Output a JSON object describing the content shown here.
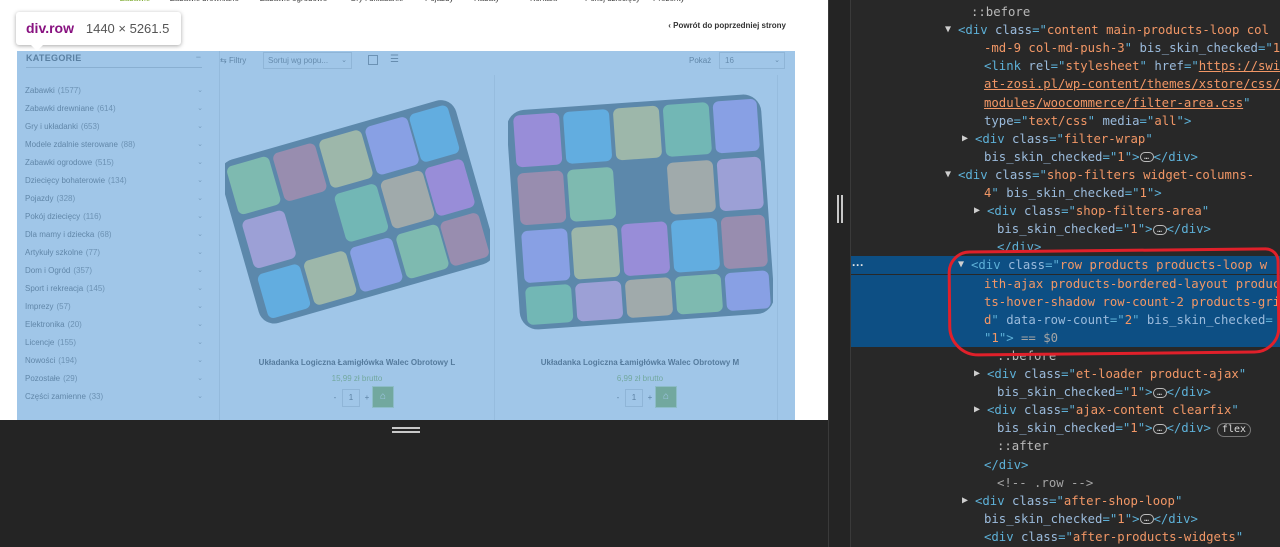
{
  "page": {
    "nav_items": [
      "Zabawki",
      "Zabawki drewniane",
      "Zabawki ogrodowe",
      "Gry i układanki",
      "Pojazdy",
      "Rabaty",
      "Kontakt",
      "Pokój dziecięcy",
      "Prezenty"
    ],
    "back_link": "‹ Powrót do poprzedniej strony",
    "categories_title": "KATEGORIE",
    "categories": [
      {
        "label": "Zabawki",
        "count": "(1577)"
      },
      {
        "label": "Zabawki drewniane",
        "count": "(614)"
      },
      {
        "label": "Gry i układanki",
        "count": "(653)"
      },
      {
        "label": "Modele zdalnie sterowane",
        "count": "(88)"
      },
      {
        "label": "Zabawki ogrodowe",
        "count": "(515)"
      },
      {
        "label": "Dziecięcy bohaterowie",
        "count": "(134)"
      },
      {
        "label": "Pojazdy",
        "count": "(328)"
      },
      {
        "label": "Pokój dziecięcy",
        "count": "(116)"
      },
      {
        "label": "Dla mamy i dziecka",
        "count": "(68)"
      },
      {
        "label": "Artykuły szkolne",
        "count": "(77)"
      },
      {
        "label": "Dom i Ogród",
        "count": "(357)"
      },
      {
        "label": "Sport i rekreacja",
        "count": "(145)"
      },
      {
        "label": "Imprezy",
        "count": "(57)"
      },
      {
        "label": "Elektronika",
        "count": "(20)"
      },
      {
        "label": "Licencje",
        "count": "(155)"
      },
      {
        "label": "Nowości",
        "count": "(194)"
      },
      {
        "label": "Pozostałe",
        "count": "(29)"
      },
      {
        "label": "Części zamienne",
        "count": "(33)"
      }
    ],
    "toolbar": {
      "filters": "Filtry",
      "sort": "Sortuj wg popu...",
      "show_label": "Pokaż",
      "show_value": "16"
    },
    "products": [
      {
        "name": "Układanka Logiczna Łamigłówka Walec Obrotowy L",
        "price": "15,99 zł brutto",
        "qty": "1"
      },
      {
        "name": "Układanka Logiczna Łamigłówka Walec Obrotowy M",
        "price": "6,99 zł brutto",
        "qty": "1"
      }
    ]
  },
  "inspect_tooltip": {
    "tag": "div.row",
    "dims": "1440 × 5261.5"
  },
  "devtools": {
    "lines": [
      {
        "tri": "",
        "pre": "",
        "parts": [
          [
            "pseudo",
            "::before"
          ]
        ]
      },
      {
        "tri": "▼",
        "pre": "",
        "parts": [
          [
            "tg",
            "<div "
          ],
          [
            "an",
            "class"
          ],
          [
            "tg",
            "=\""
          ],
          [
            "av",
            "content main-products-loop col"
          ]
        ]
      },
      {
        "tri": "",
        "pre": "",
        "parts": [
          [
            "av",
            "-md-9 col-md-push-3"
          ],
          [
            "tg",
            "\" "
          ],
          [
            "an",
            "bis_skin_checked"
          ],
          [
            "tg",
            "=\""
          ],
          [
            "av",
            "1"
          ],
          [
            "tg",
            "\">"
          ]
        ]
      },
      {
        "tri": "",
        "pre": "",
        "parts": [
          [
            "tg",
            "<link "
          ],
          [
            "an",
            "rel"
          ],
          [
            "tg",
            "=\""
          ],
          [
            "av",
            "stylesheet"
          ],
          [
            "tg",
            "\" "
          ],
          [
            "an",
            "href"
          ],
          [
            "tg",
            "=\""
          ],
          [
            "url",
            "https://swi"
          ]
        ]
      },
      {
        "tri": "",
        "pre": "",
        "parts": [
          [
            "url",
            "at-zosi.pl/wp-content/themes/xstore/css/"
          ]
        ]
      },
      {
        "tri": "",
        "pre": "",
        "parts": [
          [
            "url",
            "modules/woocommerce/filter-area.css"
          ],
          [
            "tg",
            "\""
          ]
        ]
      },
      {
        "tri": "",
        "pre": "",
        "parts": [
          [
            "an",
            "type"
          ],
          [
            "tg",
            "=\""
          ],
          [
            "av",
            "text/css"
          ],
          [
            "tg",
            "\" "
          ],
          [
            "an",
            "media"
          ],
          [
            "tg",
            "=\""
          ],
          [
            "av",
            "all"
          ],
          [
            "tg",
            "\">"
          ]
        ]
      },
      {
        "tri": "▶",
        "pre": "",
        "parts": [
          [
            "tg",
            "<div "
          ],
          [
            "an",
            "class"
          ],
          [
            "tg",
            "=\""
          ],
          [
            "av",
            "filter-wrap"
          ],
          [
            "tg",
            "\""
          ]
        ]
      },
      {
        "tri": "",
        "pre": "",
        "parts": [
          [
            "an",
            "bis_skin_checked"
          ],
          [
            "tg",
            "=\""
          ],
          [
            "av",
            "1"
          ],
          [
            "tg",
            "\">"
          ],
          [
            "ell",
            "…"
          ],
          [
            "tg",
            "</div>"
          ]
        ]
      },
      {
        "tri": "▼",
        "pre": "",
        "parts": [
          [
            "tg",
            "<div "
          ],
          [
            "an",
            "class"
          ],
          [
            "tg",
            "=\""
          ],
          [
            "av",
            "shop-filters widget-columns-"
          ]
        ]
      },
      {
        "tri": "",
        "pre": "",
        "parts": [
          [
            "av",
            "4"
          ],
          [
            "tg",
            "\" "
          ],
          [
            "an",
            "bis_skin_checked"
          ],
          [
            "tg",
            "=\""
          ],
          [
            "av",
            "1"
          ],
          [
            "tg",
            "\">"
          ]
        ]
      },
      {
        "tri": "▶",
        "pre": "",
        "parts": [
          [
            "tg",
            "<div "
          ],
          [
            "an",
            "class"
          ],
          [
            "tg",
            "=\""
          ],
          [
            "av",
            "shop-filters-area"
          ],
          [
            "tg",
            "\""
          ]
        ]
      },
      {
        "tri": "",
        "pre": "",
        "parts": [
          [
            "an",
            "bis_skin_checked"
          ],
          [
            "tg",
            "=\""
          ],
          [
            "av",
            "1"
          ],
          [
            "tg",
            "\">"
          ],
          [
            "ell",
            "…"
          ],
          [
            "tg",
            "</div>"
          ]
        ]
      },
      {
        "tri": "",
        "pre": "",
        "parts": [
          [
            "tg",
            "</div>"
          ]
        ]
      },
      {
        "tri": "▼",
        "pre": "",
        "parts": [
          [
            "tg",
            "<div "
          ],
          [
            "an",
            "class"
          ],
          [
            "tg",
            "=\""
          ],
          [
            "av",
            "row products products-loop w"
          ]
        ]
      },
      {
        "tri": "",
        "pre": "",
        "parts": [
          [
            "av",
            "ith-ajax products-bordered-layout produc"
          ]
        ]
      },
      {
        "tri": "",
        "pre": "",
        "parts": [
          [
            "av",
            "ts-hover-shadow row-count-2 products-gri"
          ]
        ]
      },
      {
        "tri": "",
        "pre": "",
        "parts": [
          [
            "av",
            "d"
          ],
          [
            "tg",
            "\" "
          ],
          [
            "an",
            "data-row-count"
          ],
          [
            "tg",
            "=\""
          ],
          [
            "av",
            "2"
          ],
          [
            "tg",
            "\" "
          ],
          [
            "an",
            "bis_skin_checked"
          ],
          [
            "tg",
            "="
          ]
        ]
      },
      {
        "tri": "",
        "pre": "",
        "parts": [
          [
            "tg",
            "\""
          ],
          [
            "av",
            "1"
          ],
          [
            "tg",
            "\">"
          ],
          [
            "com",
            " == "
          ],
          [
            "com",
            "$0"
          ]
        ]
      },
      {
        "tri": "",
        "pre": "",
        "parts": [
          [
            "pseudo",
            "::before"
          ]
        ]
      },
      {
        "tri": "▶",
        "pre": "",
        "parts": [
          [
            "tg",
            "<div "
          ],
          [
            "an",
            "class"
          ],
          [
            "tg",
            "=\""
          ],
          [
            "av",
            "et-loader product-ajax"
          ],
          [
            "tg",
            "\""
          ]
        ]
      },
      {
        "tri": "",
        "pre": "",
        "parts": [
          [
            "an",
            "bis_skin_checked"
          ],
          [
            "tg",
            "=\""
          ],
          [
            "av",
            "1"
          ],
          [
            "tg",
            "\">"
          ],
          [
            "ell",
            "…"
          ],
          [
            "tg",
            "</div>"
          ]
        ]
      },
      {
        "tri": "▶",
        "pre": "",
        "parts": [
          [
            "tg",
            "<div "
          ],
          [
            "an",
            "class"
          ],
          [
            "tg",
            "=\""
          ],
          [
            "av",
            "ajax-content clearfix"
          ],
          [
            "tg",
            "\""
          ]
        ]
      },
      {
        "tri": "",
        "pre": "",
        "parts": [
          [
            "an",
            "bis_skin_checked"
          ],
          [
            "tg",
            "=\""
          ],
          [
            "av",
            "1"
          ],
          [
            "tg",
            "\">"
          ],
          [
            "ell",
            "…"
          ],
          [
            "tg",
            "</div>"
          ],
          [
            "badge",
            "flex"
          ]
        ]
      },
      {
        "tri": "",
        "pre": "",
        "parts": [
          [
            "pseudo",
            "::after"
          ]
        ]
      },
      {
        "tri": "",
        "pre": "",
        "parts": [
          [
            "tg",
            "</div>"
          ]
        ]
      },
      {
        "tri": "",
        "pre": "",
        "parts": [
          [
            "com",
            "<!-- .row -->"
          ]
        ]
      },
      {
        "tri": "▶",
        "pre": "",
        "parts": [
          [
            "tg",
            "<div "
          ],
          [
            "an",
            "class"
          ],
          [
            "tg",
            "=\""
          ],
          [
            "av",
            "after-shop-loop"
          ],
          [
            "tg",
            "\""
          ]
        ]
      },
      {
        "tri": "",
        "pre": "",
        "parts": [
          [
            "an",
            "bis_skin_checked"
          ],
          [
            "tg",
            "=\""
          ],
          [
            "av",
            "1"
          ],
          [
            "tg",
            "\">"
          ],
          [
            "ell",
            "…"
          ],
          [
            "tg",
            "</div>"
          ]
        ]
      },
      {
        "tri": "",
        "pre": "",
        "parts": [
          [
            "tg",
            "<div "
          ],
          [
            "an",
            "class"
          ],
          [
            "tg",
            "=\""
          ],
          [
            "av",
            "after-products-widgets"
          ],
          [
            "tg",
            "\""
          ]
        ]
      }
    ],
    "selected_line_indices": [
      14,
      15,
      16,
      17,
      18
    ]
  },
  "colors": {
    "accent_green": "#7aa82a",
    "selection_blue": "#0d4f84",
    "highlight_overlay": "#6fa8dc",
    "annotation_red": "#e0202a"
  }
}
